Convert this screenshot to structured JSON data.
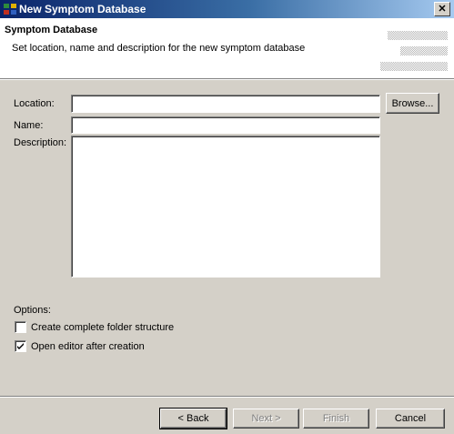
{
  "window": {
    "title": "New Symptom Database",
    "close_glyph": "✕",
    "icon": "app-icon"
  },
  "header": {
    "heading": "Symptom Database",
    "description": "Set location, name and description for the new symptom database"
  },
  "form": {
    "location_label": "Location:",
    "location_value": "",
    "browse_label": "Browse...",
    "name_label": "Name:",
    "name_value": "",
    "description_label": "Description:",
    "description_value": ""
  },
  "options": {
    "label": "Options:",
    "items": [
      {
        "label": "Create complete folder structure",
        "checked": false
      },
      {
        "label": "Open editor after creation",
        "checked": true
      }
    ]
  },
  "buttons": {
    "back": "< Back",
    "next": "Next >",
    "finish": "Finish",
    "cancel": "Cancel"
  }
}
